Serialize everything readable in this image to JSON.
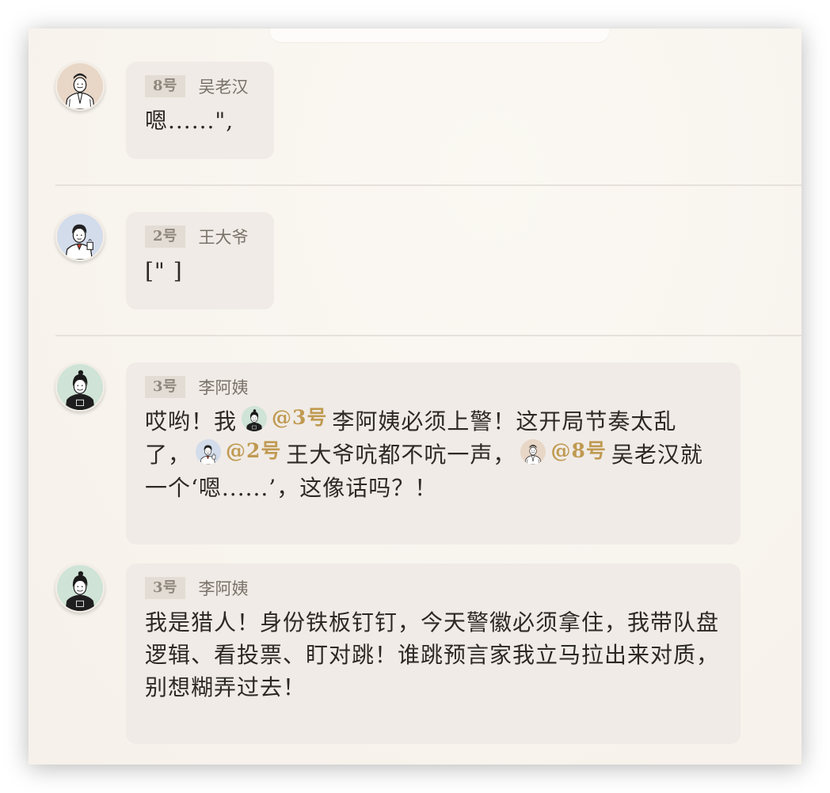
{
  "messages": [
    {
      "seat": "8号",
      "speaker": "吴老汉",
      "avatar_icon": "elderly-man-avatar-icon",
      "text": "嗯......\","
    },
    {
      "seat": "2号",
      "speaker": "王大爷",
      "avatar_icon": "old-man-with-tea-avatar-icon",
      "text": "[\" ]"
    },
    {
      "seat": "3号",
      "speaker": "李阿姨",
      "avatar_icon": "auntie-avatar-icon",
      "text_seg_1": "哎哟！我",
      "mention_1": "@3号",
      "text_seg_2": "李阿姨必须上警！这开局节奏太乱了，",
      "mention_2": "@2号",
      "text_seg_3": "王大爷吭都不吭一声，",
      "mention_3": "@8号",
      "text_seg_4": "吴老汉就一个‘嗯......’，这像话吗？！"
    },
    {
      "seat": "3号",
      "speaker": "李阿姨",
      "avatar_icon": "auntie-avatar-icon",
      "text": "我是猎人！身份铁板钉钉，今天警徽必须拿住，我带队盘逻辑、看投票、盯对跳！谁跳预言家我立马拉出来对质，别想糊弄过去！"
    }
  ],
  "colors": {
    "mention": "#c09a52",
    "bubble": "#f0ebe6",
    "badge": "#e3dcd4"
  }
}
